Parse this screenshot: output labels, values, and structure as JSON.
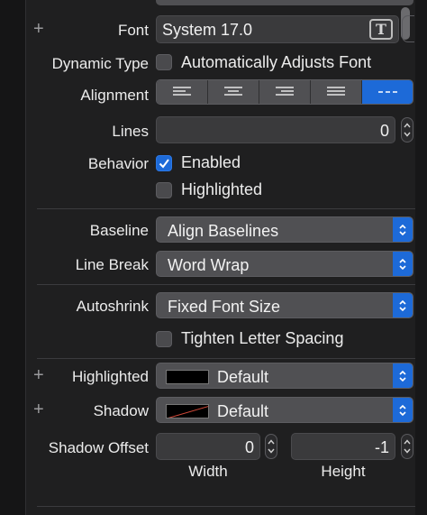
{
  "font": {
    "label": "Font",
    "value": "System 17.0"
  },
  "dynamic_type": {
    "label": "Dynamic Type",
    "checkbox_label": "Automatically Adjusts Font",
    "checked": false
  },
  "alignment": {
    "label": "Alignment",
    "options": [
      "left",
      "center",
      "right",
      "justified",
      "natural"
    ],
    "selected": "natural"
  },
  "lines": {
    "label": "Lines",
    "value": "0"
  },
  "behavior": {
    "label": "Behavior",
    "enabled_label": "Enabled",
    "enabled_checked": true,
    "highlighted_label": "Highlighted",
    "highlighted_checked": false
  },
  "baseline": {
    "label": "Baseline",
    "value": "Align Baselines"
  },
  "line_break": {
    "label": "Line Break",
    "value": "Word Wrap"
  },
  "autoshrink": {
    "label": "Autoshrink",
    "value": "Fixed Font Size",
    "tighten_label": "Tighten Letter Spacing",
    "tighten_checked": false
  },
  "highlighted_color": {
    "label": "Highlighted",
    "value": "Default",
    "swatch_color": "#000000"
  },
  "shadow_color": {
    "label": "Shadow",
    "value": "Default"
  },
  "shadow_offset": {
    "label": "Shadow Offset",
    "width_value": "0",
    "height_value": "-1",
    "width_caption": "Width",
    "height_caption": "Height"
  },
  "colors": {
    "accent": "#1d6ad8",
    "panel": "#1f1f20",
    "control": "#505053"
  }
}
